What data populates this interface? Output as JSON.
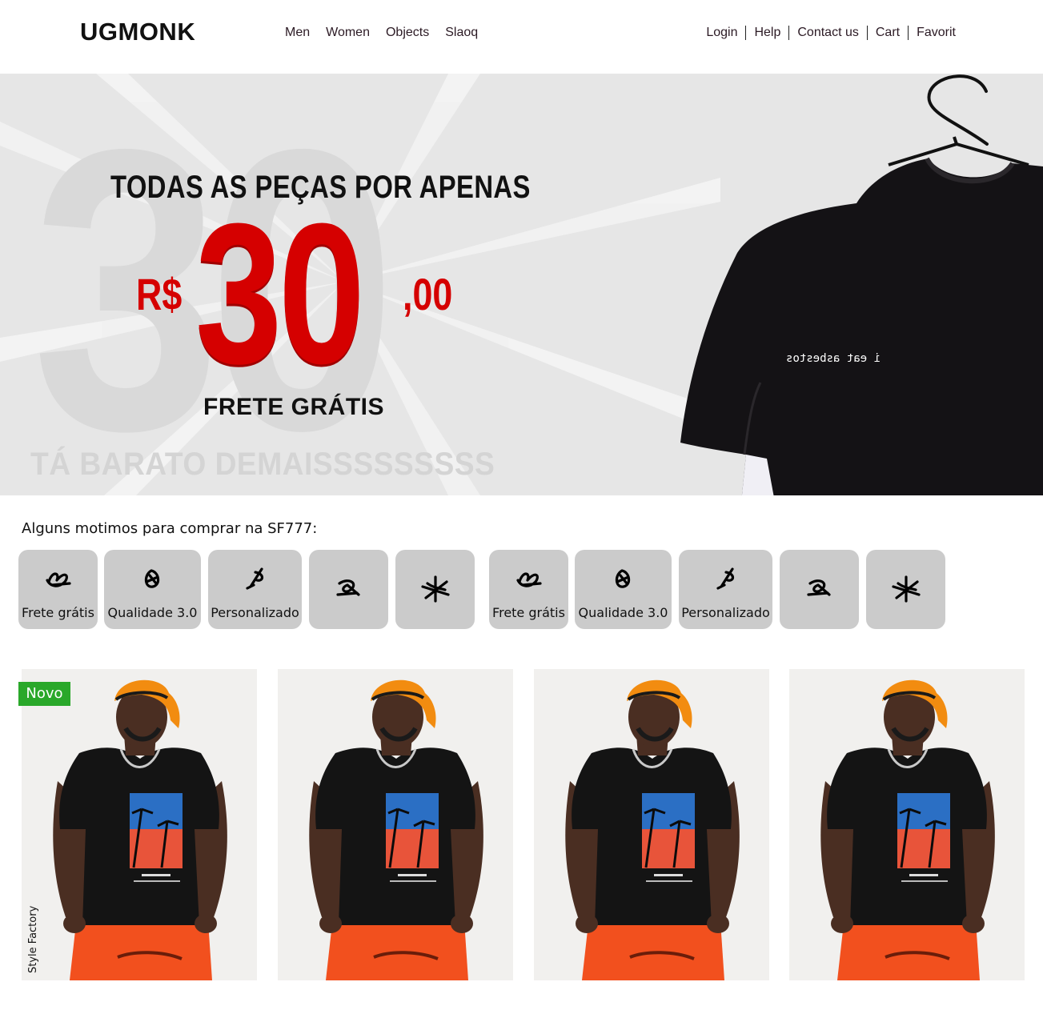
{
  "header": {
    "logo": "UGMONK",
    "nav_left": [
      "Men",
      "Women",
      "Objects",
      "Slaoq"
    ],
    "nav_right": [
      "Login",
      "Help",
      "Contact us",
      "Cart",
      "Favorit"
    ]
  },
  "hero": {
    "background_number": "30",
    "headline": "TODAS AS PEÇAS POR APENAS",
    "currency": "R$",
    "price": "30",
    "cents": ",00",
    "subline": "FRETE GRÁTIS",
    "tagline": "TÁ BARATO DEMAISSSSSSSSS",
    "shirt_print": "i eat asbestos",
    "accent_color": "#d50000"
  },
  "reasons": {
    "title": "Alguns motimos para comprar na SF777:",
    "items": [
      {
        "label": "Frete grátis",
        "icon": "scribble-icon"
      },
      {
        "label": "Qualidade 3.0",
        "icon": "scribble-icon"
      },
      {
        "label": "Personalizado",
        "icon": "scribble-icon"
      },
      {
        "label": "",
        "icon": "scribble-icon"
      },
      {
        "label": "",
        "icon": "scribble-icon"
      },
      {
        "label": "Frete grátis",
        "icon": "scribble-icon"
      },
      {
        "label": "Qualidade 3.0",
        "icon": "scribble-icon"
      },
      {
        "label": "Personalizado",
        "icon": "scribble-icon"
      },
      {
        "label": "",
        "icon": "scribble-icon"
      },
      {
        "label": "",
        "icon": "scribble-icon"
      }
    ]
  },
  "products": {
    "badge": "Novo",
    "watermark": "Style Factory",
    "count": 4
  }
}
